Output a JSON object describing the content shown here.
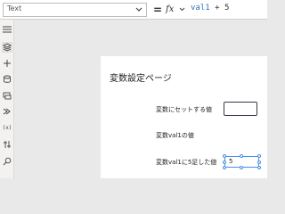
{
  "formula_bar": {
    "property": "Text",
    "equals": "=",
    "fx_label": "fx",
    "formula_name": "val1",
    "formula_rest": " + 5"
  },
  "left_rail": {
    "icons": [
      "hamburger-menu-icon",
      "layers-icon",
      "insert-plus-icon",
      "data-cylinder-icon",
      "media-icon",
      "power-automate-icon",
      "variables-icon",
      "advanced-tools-icon",
      "search-icon"
    ],
    "variables_label": "(x)"
  },
  "canvas": {
    "title": "変数設定ページ",
    "labels": {
      "set_value": "変数にセットする値",
      "val1_value": "変数val1の値",
      "val1_plus5": "変数val1に5足した値"
    },
    "input_value": "",
    "result_value": "5"
  },
  "colors": {
    "accent": "#4a90e2",
    "canvas_bg": "#e9e9e9",
    "input_border": "#333a4b"
  }
}
